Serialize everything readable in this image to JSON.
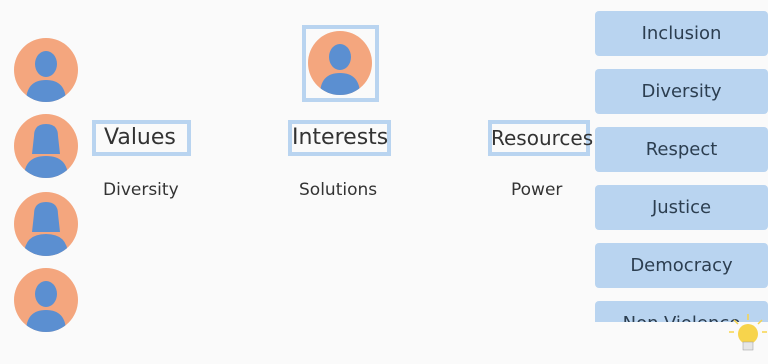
{
  "columns": [
    {
      "heading": "Values",
      "subtext": "Diversity"
    },
    {
      "heading": "Interests",
      "subtext": "Solutions"
    },
    {
      "heading": "Resources",
      "subtext": "Power"
    }
  ],
  "tiles": [
    "Inclusion",
    "Diversity",
    "Respect",
    "Justice",
    "Democracy",
    "Non-Violence"
  ],
  "colors": {
    "avatar_bg": "#f4a67e",
    "avatar_figure": "#5b8fd1",
    "highlight": "#b9d4f0",
    "tile": "#b9d4f0",
    "bulb": "#f7d44c"
  },
  "icons": [
    "person-avatar-icon",
    "lightbulb-icon"
  ]
}
